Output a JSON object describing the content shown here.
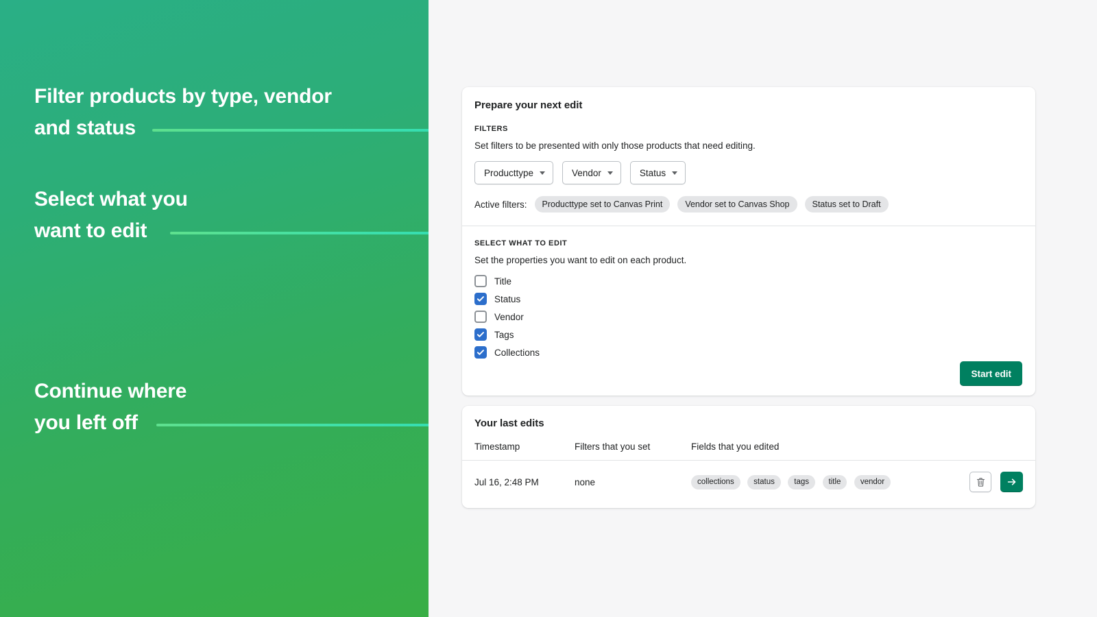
{
  "promo": {
    "blocks": [
      {
        "line1": "Filter products by type, vendor",
        "line2": "and status"
      },
      {
        "line1": "Select what you",
        "line2": "want to edit"
      },
      {
        "line1": "Continue where",
        "line2": "you left off"
      }
    ],
    "gradient_from": "#2aaf86",
    "gradient_to": "#38ae45",
    "connector_color": "#3fe0a9"
  },
  "prepare_card": {
    "title": "Prepare your next edit",
    "filters": {
      "label": "FILTERS",
      "description": "Set filters to be presented with only those products that need editing.",
      "dropdowns": [
        {
          "label": "Producttype",
          "icon": "chevron-down-icon"
        },
        {
          "label": "Vendor",
          "icon": "chevron-down-icon"
        },
        {
          "label": "Status",
          "icon": "chevron-down-icon"
        }
      ],
      "active_label": "Active filters:",
      "active_chips": [
        "Producttype set to Canvas Print",
        "Vendor set to Canvas Shop",
        "Status set to Draft"
      ]
    },
    "select_edit": {
      "label": "SELECT WHAT TO EDIT",
      "description": "Set the properties you want to edit on each product.",
      "checkboxes": [
        {
          "label": "Title",
          "checked": false
        },
        {
          "label": "Status",
          "checked": true
        },
        {
          "label": "Vendor",
          "checked": false
        },
        {
          "label": "Tags",
          "checked": true
        },
        {
          "label": "Collections",
          "checked": true
        }
      ]
    },
    "start_edit_label": "Start edit",
    "accent_color": "#008060",
    "checkbox_color": "#2c6ecb"
  },
  "last_edits_card": {
    "title": "Your last edits",
    "columns": [
      "Timestamp",
      "Filters that you set",
      "Fields that you edited"
    ],
    "rows": [
      {
        "timestamp": "Jul 16, 2:48 PM",
        "filters": "none",
        "fields": [
          "collections",
          "status",
          "tags",
          "title",
          "vendor"
        ],
        "delete_icon": "trash-icon",
        "continue_icon": "arrow-right-icon"
      }
    ]
  }
}
